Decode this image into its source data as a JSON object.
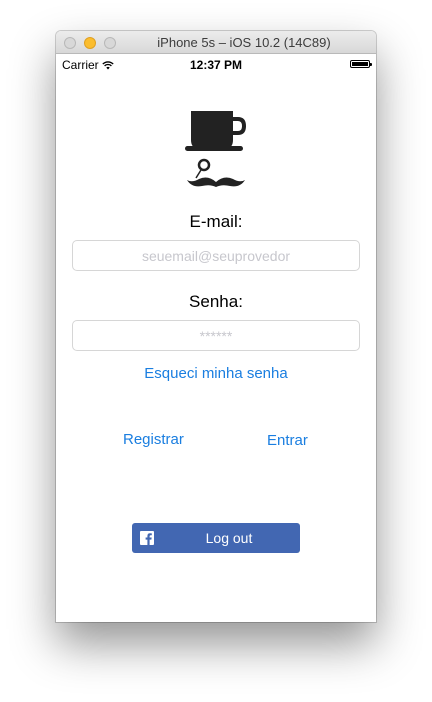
{
  "window": {
    "title": "iPhone 5s – iOS 10.2 (14C89)"
  },
  "status_bar": {
    "carrier": "Carrier",
    "time": "12:37 PM",
    "wifi_icon": "wifi-icon",
    "battery_icon": "battery-icon",
    "battery_level": 1.0
  },
  "logo": {
    "icon": "coffee-cup-mustache-logo"
  },
  "form": {
    "email_label": "E-mail:",
    "email_placeholder": "seuemail@seuprovedor",
    "email_value": "",
    "password_label": "Senha:",
    "password_placeholder": "******",
    "password_value": "",
    "forgot_password": "Esqueci minha senha"
  },
  "actions": {
    "register": "Registrar",
    "login": "Entrar"
  },
  "facebook": {
    "icon": "facebook-icon",
    "label": "Log out"
  },
  "colors": {
    "link": "#1a7ee0",
    "facebook_blue": "#4267b2",
    "minimize_yellow": "#fbbd2e"
  }
}
